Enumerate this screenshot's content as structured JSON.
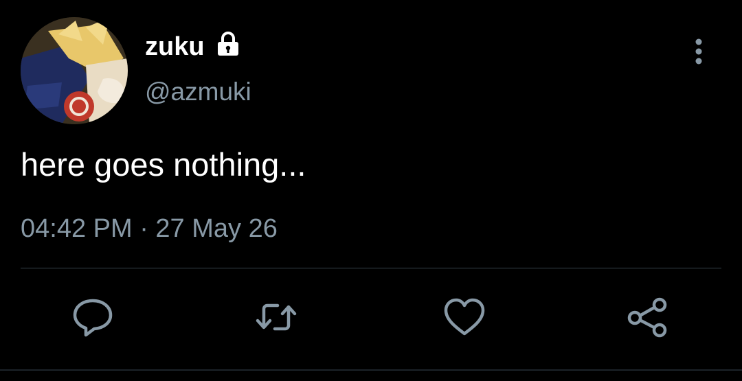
{
  "tweet": {
    "display_name": "zuku",
    "handle": "@azmuki",
    "text": "here goes nothing...",
    "timestamp": "04:42 PM · 27 May 26"
  },
  "icons": {
    "lock": "lock-icon",
    "more": "more-vertical-icon",
    "reply": "reply-icon",
    "retweet": "retweet-icon",
    "like": "heart-icon",
    "share": "share-icon"
  },
  "colors": {
    "background": "#000000",
    "primary_text": "#ffffff",
    "secondary_text": "#8899a6",
    "divider": "#38444d"
  }
}
